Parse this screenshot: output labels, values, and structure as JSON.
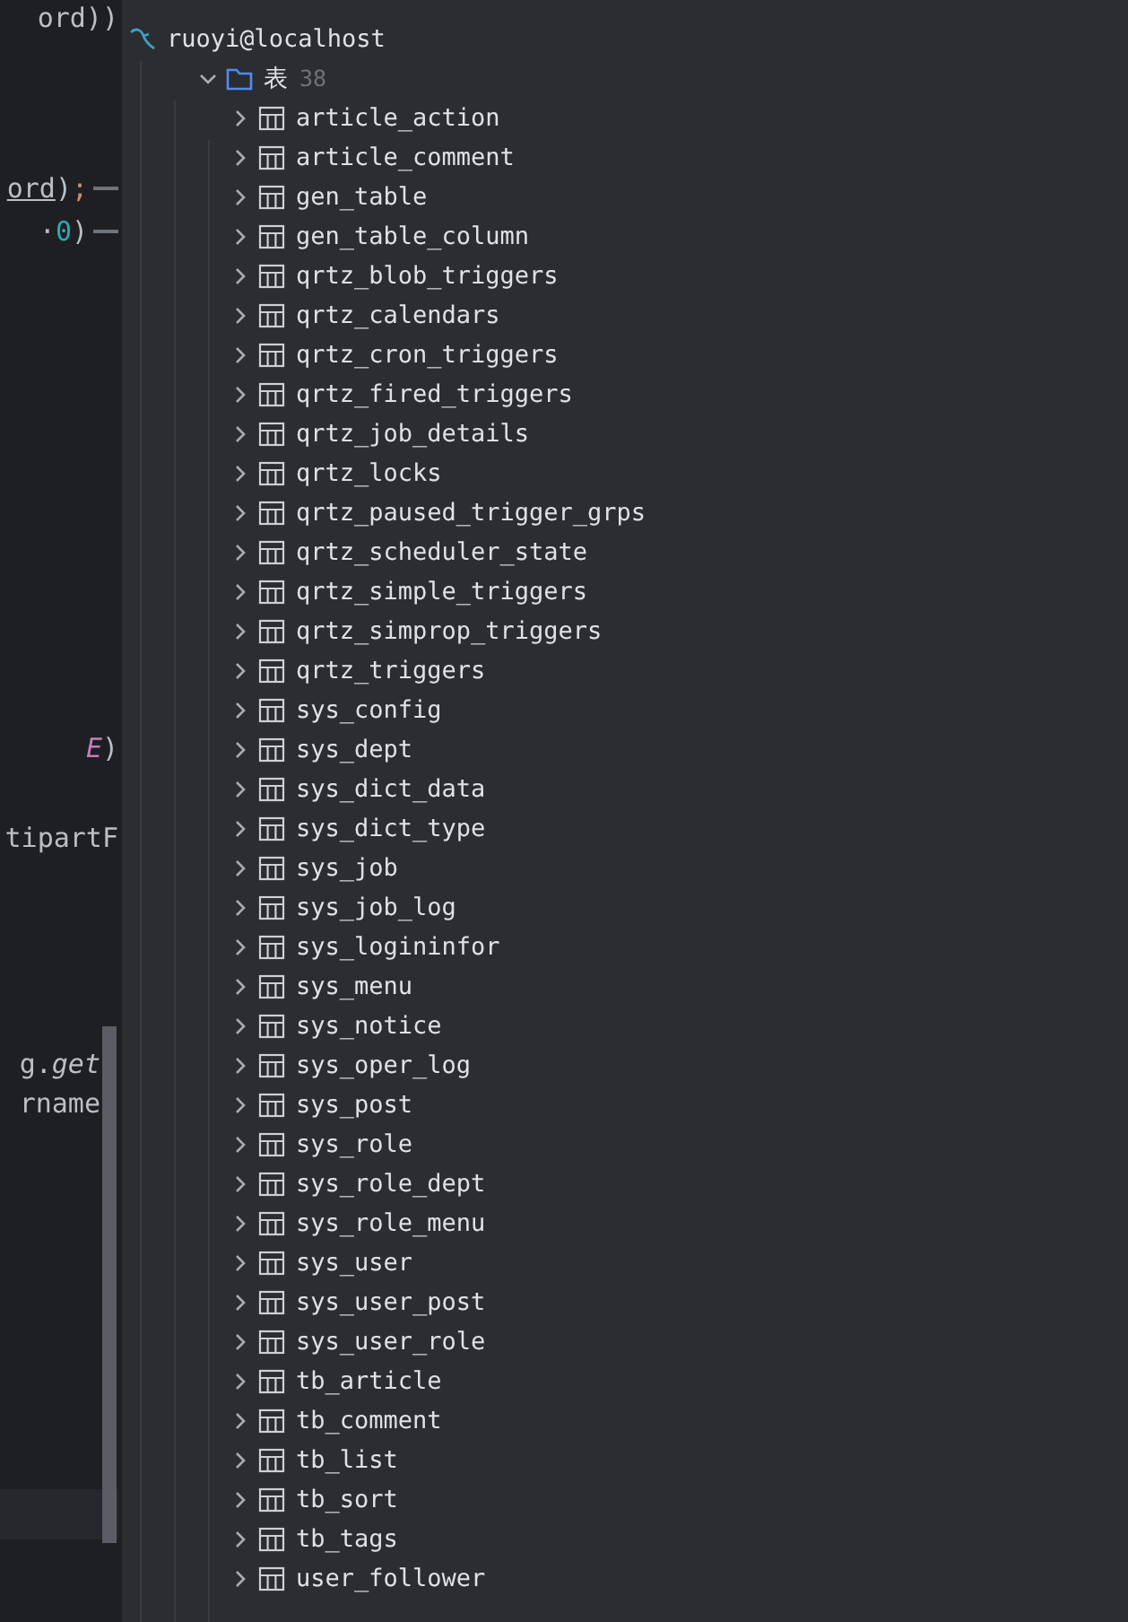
{
  "editor": {
    "lines": [
      {
        "segments": [
          {
            "text": "ord))",
            "kind": "plain"
          }
        ]
      },
      {
        "segments": [
          {
            "text": "ord",
            "kind": "underline"
          },
          {
            "text": ")",
            "kind": "plain"
          },
          {
            "text": ";",
            "kind": "keyword"
          }
        ],
        "hint": true
      },
      {
        "segments": [
          {
            "text": "· ",
            "kind": "plain"
          },
          {
            "text": "0",
            "kind": "number"
          },
          {
            "text": ")",
            "kind": "plain"
          }
        ],
        "hint": true
      },
      {
        "segments": [
          {
            "text": "E",
            "kind": "constant"
          },
          {
            "text": ")",
            "kind": "plain"
          }
        ]
      },
      {
        "segments": [
          {
            "text": "tipartF",
            "kind": "plain"
          }
        ]
      },
      {
        "segments": [
          {
            "text": "g.",
            "kind": "plain"
          },
          {
            "text": "get",
            "kind": "call"
          }
        ]
      },
      {
        "segments": [
          {
            "text": "rname",
            "kind": "plain"
          }
        ]
      }
    ]
  },
  "tree": {
    "root": {
      "label": "ruoyi@localhost",
      "children": [
        {
          "label": "表",
          "count": "38",
          "expanded": true,
          "children": [
            {
              "label": "article_action",
              "expanded": false
            },
            {
              "label": "article_comment",
              "expanded": false
            },
            {
              "label": "gen_table",
              "expanded": false
            },
            {
              "label": "gen_table_column",
              "expanded": false
            },
            {
              "label": "qrtz_blob_triggers",
              "expanded": false
            },
            {
              "label": "qrtz_calendars",
              "expanded": false
            },
            {
              "label": "qrtz_cron_triggers",
              "expanded": false
            },
            {
              "label": "qrtz_fired_triggers",
              "expanded": false
            },
            {
              "label": "qrtz_job_details",
              "expanded": false
            },
            {
              "label": "qrtz_locks",
              "expanded": false
            },
            {
              "label": "qrtz_paused_trigger_grps",
              "expanded": false
            },
            {
              "label": "qrtz_scheduler_state",
              "expanded": false
            },
            {
              "label": "qrtz_simple_triggers",
              "expanded": false
            },
            {
              "label": "qrtz_simprop_triggers",
              "expanded": false
            },
            {
              "label": "qrtz_triggers",
              "expanded": false
            },
            {
              "label": "sys_config",
              "expanded": false
            },
            {
              "label": "sys_dept",
              "expanded": false
            },
            {
              "label": "sys_dict_data",
              "expanded": false
            },
            {
              "label": "sys_dict_type",
              "expanded": false
            },
            {
              "label": "sys_job",
              "expanded": false
            },
            {
              "label": "sys_job_log",
              "expanded": false
            },
            {
              "label": "sys_logininfor",
              "expanded": false
            },
            {
              "label": "sys_menu",
              "expanded": false
            },
            {
              "label": "sys_notice",
              "expanded": false
            },
            {
              "label": "sys_oper_log",
              "expanded": false
            },
            {
              "label": "sys_post",
              "expanded": false
            },
            {
              "label": "sys_role",
              "expanded": false
            },
            {
              "label": "sys_role_dept",
              "expanded": false
            },
            {
              "label": "sys_role_menu",
              "expanded": false
            },
            {
              "label": "sys_user",
              "expanded": false
            },
            {
              "label": "sys_user_post",
              "expanded": false
            },
            {
              "label": "sys_user_role",
              "expanded": false
            },
            {
              "label": "tb_article",
              "expanded": false
            },
            {
              "label": "tb_comment",
              "expanded": false
            },
            {
              "label": "tb_list",
              "expanded": false
            },
            {
              "label": "tb_sort",
              "expanded": false
            },
            {
              "label": "tb_tags",
              "expanded": false
            },
            {
              "label": "user_follower",
              "expanded": false
            }
          ]
        }
      ]
    }
  }
}
